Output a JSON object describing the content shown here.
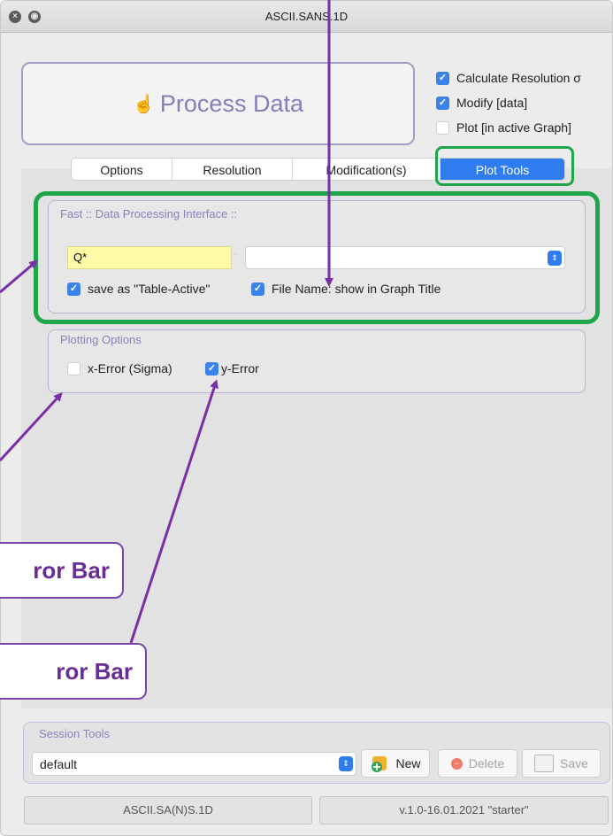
{
  "window": {
    "title": "ASCII.SANS.1D"
  },
  "header": {
    "process_label": "Process Data",
    "options": [
      {
        "label": "Calculate Resolution σ",
        "checked": true
      },
      {
        "label": "Modify [data]",
        "checked": true
      },
      {
        "label": "Plot [in active Graph]",
        "checked": false
      }
    ]
  },
  "tabs": [
    {
      "label": "Options",
      "active": false
    },
    {
      "label": "Resolution",
      "active": false
    },
    {
      "label": "Modification(s)",
      "active": false
    },
    {
      "label": "Plot Tools",
      "active": true
    }
  ],
  "fast_panel": {
    "title": "Fast :: Data Processing Interface ::",
    "q_field_value": "Q*",
    "select_value": "",
    "save_table": {
      "label": "save as \"Table-Active\"",
      "checked": true
    },
    "file_name": {
      "label": "File Name: show in Graph Title",
      "checked": true
    }
  },
  "plotting_options": {
    "title": "Plotting Options",
    "x_error": {
      "label": "x-Error (Sigma)",
      "checked": false
    },
    "y_error": {
      "label": "y-Error",
      "checked": true
    }
  },
  "annotations": {
    "x_error_bar": "ror Bar",
    "y_error_bar": "ror Bar"
  },
  "session": {
    "title": "Session Tools",
    "selected": "default",
    "new_label": "New",
    "delete_label": "Delete",
    "save_label": "Save"
  },
  "footer": {
    "app_name": "ASCII.SA(N)S.1D",
    "version": "v.1.0-16.01.2021 \"starter\""
  },
  "colors": {
    "accent": "#2f7bf0",
    "highlight_green": "#1fa54a",
    "annotation_purple": "#6a2d96"
  }
}
